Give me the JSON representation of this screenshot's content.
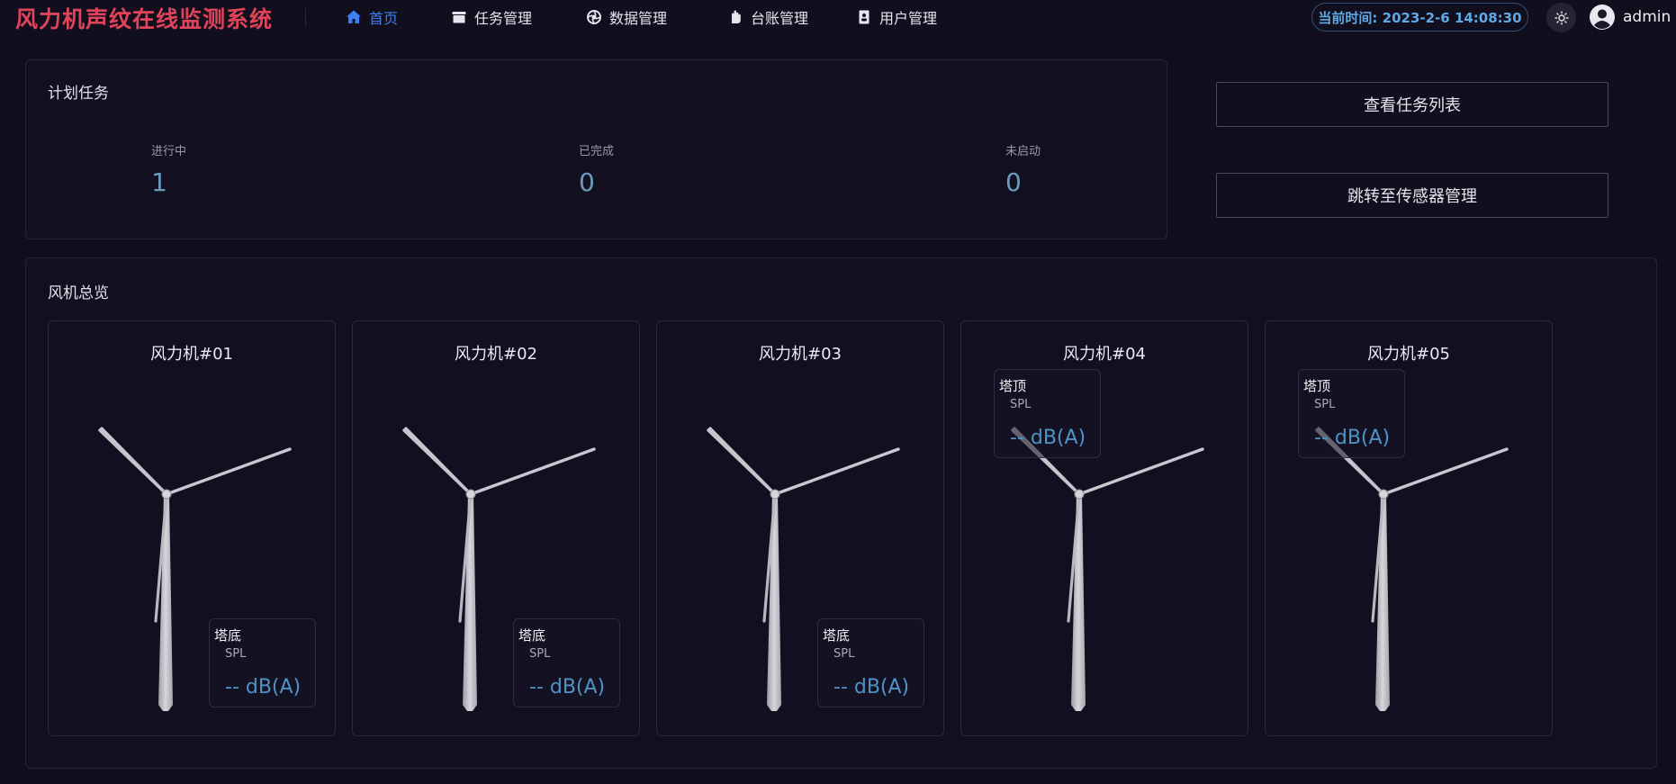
{
  "header": {
    "app_title": "风力机声纹在线监测系统",
    "nav": [
      {
        "label": "首页",
        "icon": "home-icon",
        "active": true
      },
      {
        "label": "任务管理",
        "icon": "folder-icon",
        "active": false
      },
      {
        "label": "数据管理",
        "icon": "aperture-icon",
        "active": false
      },
      {
        "label": "台账管理",
        "icon": "hand-icon",
        "active": false
      },
      {
        "label": "用户管理",
        "icon": "user-file-icon",
        "active": false
      }
    ],
    "time_label": "当前时间: 2023-2-6 14:08:30",
    "theme_icon": "sun-icon",
    "username": "admin"
  },
  "plan": {
    "title": "计划任务",
    "stats": [
      {
        "label": "进行中",
        "value": "1"
      },
      {
        "label": "已完成",
        "value": "0"
      },
      {
        "label": "未启动",
        "value": "0"
      }
    ]
  },
  "actions": {
    "task_list": "查看任务列表",
    "sensor_mgmt": "跳转至传感器管理"
  },
  "fleet": {
    "title": "风机总览",
    "turbines": [
      {
        "name": "风力机#01",
        "sensor": {
          "name": "塔底",
          "metric": "SPL",
          "value": "-- dB(A)",
          "position": "bottom"
        }
      },
      {
        "name": "风力机#02",
        "sensor": {
          "name": "塔底",
          "metric": "SPL",
          "value": "-- dB(A)",
          "position": "bottom"
        }
      },
      {
        "name": "风力机#03",
        "sensor": {
          "name": "塔底",
          "metric": "SPL",
          "value": "-- dB(A)",
          "position": "bottom"
        }
      },
      {
        "name": "风力机#04",
        "sensor": {
          "name": "塔顶",
          "metric": "SPL",
          "value": "-- dB(A)",
          "position": "top"
        }
      },
      {
        "name": "风力机#05",
        "sensor": {
          "name": "塔顶",
          "metric": "SPL",
          "value": "-- dB(A)",
          "position": "top"
        }
      }
    ]
  },
  "colors": {
    "title_red": "#e0445a",
    "nav_active": "#3d7ff0",
    "time_text": "#5ea9e6",
    "value_blue": "#4f93c6"
  }
}
